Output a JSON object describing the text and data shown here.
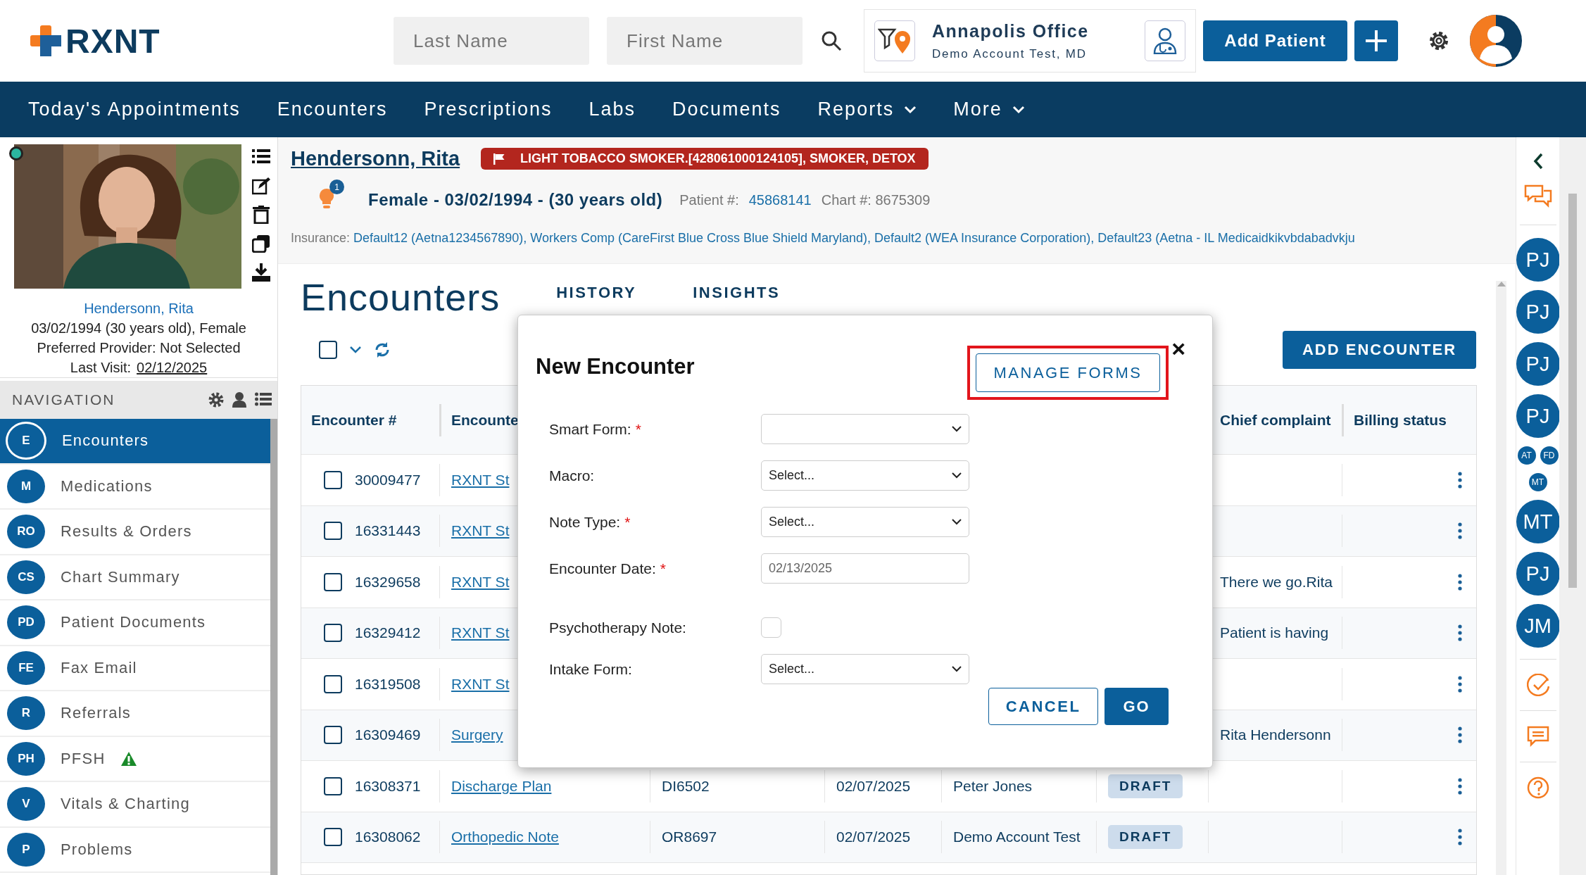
{
  "header": {
    "logo": "RXNT",
    "last_name": {
      "placeholder": "Last Name"
    },
    "first_name": {
      "placeholder": "First Name"
    },
    "office": {
      "name": "Annapolis Office",
      "account": "Demo Account Test, MD"
    },
    "add_patient": "Add Patient"
  },
  "nav_tabs": [
    {
      "label": "Today's Appointments",
      "dropdown": false
    },
    {
      "label": "Encounters",
      "dropdown": false
    },
    {
      "label": "Prescriptions",
      "dropdown": false
    },
    {
      "label": "Labs",
      "dropdown": false
    },
    {
      "label": "Documents",
      "dropdown": false
    },
    {
      "label": "Reports",
      "dropdown": true
    },
    {
      "label": "More",
      "dropdown": true
    }
  ],
  "patient_card": {
    "name": "Hendersonn, Rita",
    "dob": "03/02/1994 (30 years old), Female",
    "provider": "Preferred Provider: Not Selected",
    "last_visit_label": "Last Visit:",
    "last_visit": "02/12/2025"
  },
  "navigation": {
    "title": "NAVIGATION",
    "items": [
      {
        "badge": "E",
        "label": "Encounters",
        "selected": true,
        "warning": false
      },
      {
        "badge": "M",
        "label": "Medications",
        "selected": false,
        "warning": false
      },
      {
        "badge": "RO",
        "label": "Results & Orders",
        "selected": false,
        "warning": false
      },
      {
        "badge": "CS",
        "label": "Chart Summary",
        "selected": false,
        "warning": false
      },
      {
        "badge": "PD",
        "label": "Patient Documents",
        "selected": false,
        "warning": false
      },
      {
        "badge": "FE",
        "label": "Fax Email",
        "selected": false,
        "warning": false
      },
      {
        "badge": "R",
        "label": "Referrals",
        "selected": false,
        "warning": false
      },
      {
        "badge": "PH",
        "label": "PFSH",
        "selected": false,
        "warning": true
      },
      {
        "badge": "V",
        "label": "Vitals & Charting",
        "selected": false,
        "warning": false
      },
      {
        "badge": "P",
        "label": "Problems",
        "selected": false,
        "warning": false
      }
    ]
  },
  "patient_header": {
    "name": "Hendersonn, Rita",
    "alert": "LIGHT TOBACCO SMOKER.[428061000124105], SMOKER, DETOX",
    "alert_count": "1",
    "demographics": "Female - 03/02/1994 - (30 years old)",
    "patient_label": "Patient #:",
    "patient_number": "45868141",
    "chart": "Chart #: 8675309",
    "insurance_label": "Insurance:",
    "insurance": "Default12 (Aetna1234567890), Workers Comp (CareFirst Blue Cross Blue Shield Maryland), Default2 (WEA Insurance Corporation), Default23 (Aetna - IL Medicaidkikvbdabadvkju"
  },
  "encounters": {
    "title": "Encounters",
    "tabs": [
      {
        "label": "HISTORY",
        "selected": false
      },
      {
        "label": "INSIGHTS",
        "selected": false
      }
    ],
    "add_button": "ADD ENCOUNTER",
    "select_all": {
      "checked": false
    },
    "table": {
      "columns": [
        "Encounter #",
        "Encounte",
        null,
        null,
        null,
        null,
        "Chief complaint",
        "Billing status"
      ],
      "rows": [
        {
          "number": "30009477",
          "checked": false,
          "form": "RXNT St"
        },
        {
          "number": "16331443",
          "checked": false,
          "form": "RXNT St"
        },
        {
          "number": "16329658",
          "checked": false,
          "form": "RXNT St",
          "complaint": "There we go.Rita"
        },
        {
          "number": "16329412",
          "checked": false,
          "form": "RXNT St",
          "complaint": "Patient is having"
        },
        {
          "number": "16319508",
          "checked": false,
          "form": "RXNT St"
        },
        {
          "number": "16309469",
          "checked": false,
          "form": "Surgery",
          "complaint": "Rita Hendersonn"
        },
        {
          "number": "16308371",
          "checked": false,
          "form": "Discharge Plan",
          "code": "DI6502",
          "date": "02/07/2025",
          "provider": "Peter Jones",
          "status": "DRAFT"
        },
        {
          "number": "16308062",
          "checked": false,
          "form": "Orthopedic Note",
          "code": "OR8697",
          "date": "02/07/2025",
          "provider": "Demo Account Test",
          "status": "DRAFT"
        }
      ]
    }
  },
  "modal": {
    "title": "New Encounter",
    "manage_forms": "MANAGE FORMS",
    "highlighted": true,
    "close": "×",
    "fields": [
      {
        "kind": "select",
        "label": "Smart Form:",
        "required_mark": "*"
      },
      {
        "kind": "select",
        "label": "Macro:",
        "value": "Select..."
      },
      {
        "kind": "select",
        "label": "Note Type:",
        "required_mark": "*",
        "value": "Select..."
      },
      {
        "kind": "date",
        "label": "Encounter Date:",
        "required_mark": "*",
        "value": "02/13/2025"
      },
      {
        "kind": "checkbox",
        "label": "Psychotherapy Note:",
        "checked": false
      },
      {
        "kind": "select",
        "label": "Intake Form:",
        "value": "Select..."
      }
    ],
    "cancel": "CANCEL",
    "go": "GO"
  },
  "right_rail": {
    "avatars": [
      {
        "initials": "PJ",
        "kind": "large"
      },
      {
        "initials": "PJ",
        "kind": "large"
      },
      {
        "initials": "PJ",
        "kind": "large"
      },
      {
        "initials": "PJ",
        "kind": "large"
      },
      {
        "initials": "AT",
        "kind": "small"
      },
      {
        "initials": "FD",
        "kind": "small"
      },
      {
        "initials": "MT",
        "kind": "small"
      },
      {
        "initials": "MT",
        "kind": "large"
      },
      {
        "initials": "PJ",
        "kind": "large"
      },
      {
        "initials": "JM",
        "kind": "large"
      }
    ]
  }
}
